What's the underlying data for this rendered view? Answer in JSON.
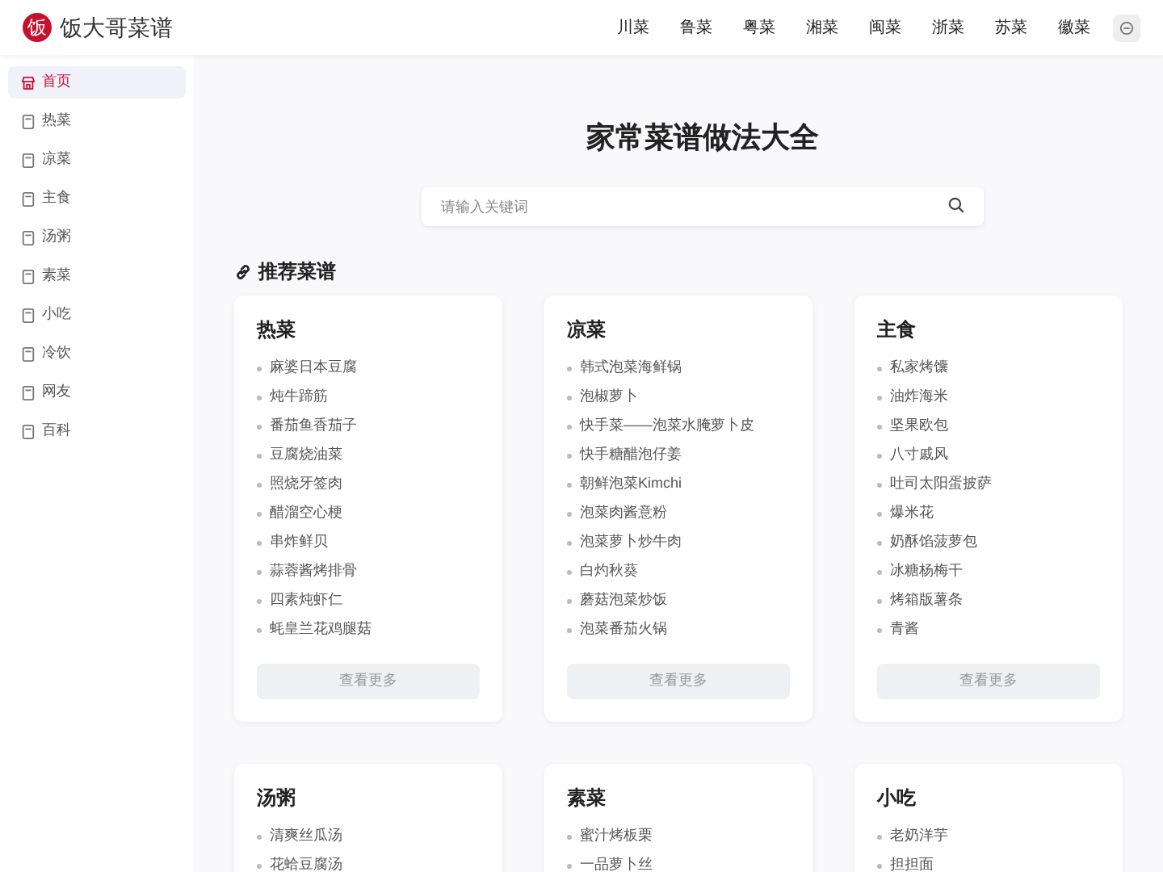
{
  "header": {
    "logo_char": "饭",
    "site_name": "饭大哥菜谱",
    "nav": [
      "川菜",
      "鲁菜",
      "粤菜",
      "湘菜",
      "闽菜",
      "浙菜",
      "苏菜",
      "徽菜"
    ]
  },
  "sidebar": {
    "items": [
      {
        "label": "首页",
        "kind": "home",
        "selected": true
      },
      {
        "label": "热菜",
        "kind": "page",
        "selected": false
      },
      {
        "label": "凉菜",
        "kind": "page",
        "selected": false
      },
      {
        "label": "主食",
        "kind": "page",
        "selected": false
      },
      {
        "label": "汤粥",
        "kind": "page",
        "selected": false
      },
      {
        "label": "素菜",
        "kind": "page",
        "selected": false
      },
      {
        "label": "小吃",
        "kind": "page",
        "selected": false
      },
      {
        "label": "冷饮",
        "kind": "page",
        "selected": false
      },
      {
        "label": "网友",
        "kind": "page",
        "selected": false
      },
      {
        "label": "百科",
        "kind": "page",
        "selected": false
      }
    ]
  },
  "hero": {
    "title": "家常菜谱做法大全",
    "search": {
      "placeholder": "请输入关键词"
    }
  },
  "section_title": "推荐菜谱",
  "cards": [
    {
      "title": "热菜",
      "items": [
        "麻婆日本豆腐",
        "炖牛蹄筋",
        "番茄鱼香茄子",
        "豆腐烧油菜",
        "照烧牙签肉",
        "醋溜空心梗",
        "串炸鲜贝",
        "蒜蓉酱烤排骨",
        "四素炖虾仁",
        "蚝皇兰花鸡腿菇"
      ],
      "more": "查看更多"
    },
    {
      "title": "凉菜",
      "items": [
        "韩式泡菜海鲜锅",
        "泡椒萝卜",
        "快手菜——泡菜水腌萝卜皮",
        "快手糖醋泡仔姜",
        "朝鲜泡菜Kimchi",
        "泡菜肉酱意粉",
        "泡菜萝卜炒牛肉",
        "白灼秋葵",
        "蘑菇泡菜炒饭",
        "泡菜番茄火锅"
      ],
      "more": "查看更多"
    },
    {
      "title": "主食",
      "items": [
        "私家烤馕",
        "油炸海米",
        "坚果欧包",
        "八寸戚风",
        "吐司太阳蛋披萨",
        "爆米花",
        "奶酥馅菠萝包",
        "冰糖杨梅干",
        "烤箱版薯条",
        "青酱"
      ],
      "more": "查看更多"
    },
    {
      "title": "汤粥",
      "items": [
        "清爽丝瓜汤",
        "花蛤豆腐汤"
      ]
    },
    {
      "title": "素菜",
      "items": [
        "蜜汁烤板栗",
        "一品萝卜丝"
      ]
    },
    {
      "title": "小吃",
      "items": [
        "老奶洋芋",
        "担担面"
      ]
    }
  ]
}
